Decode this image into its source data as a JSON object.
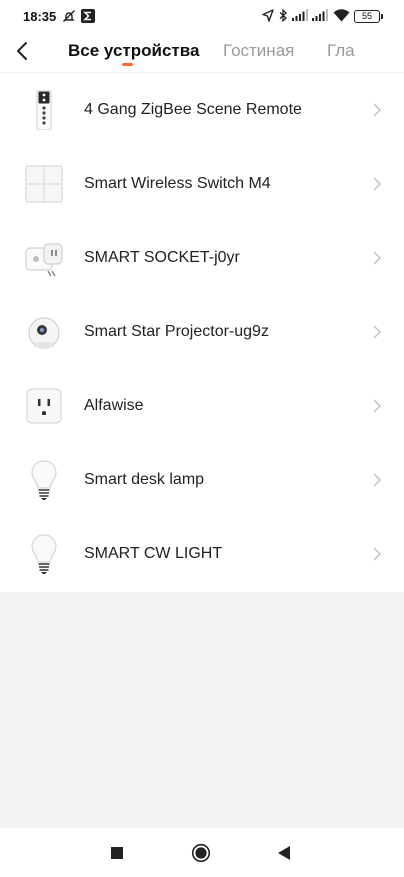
{
  "status_bar": {
    "time": "18:35",
    "battery": "55",
    "icons": [
      "alarm-off-icon",
      "sigma-app-icon",
      "location-icon",
      "bluetooth-icon",
      "signal-icon",
      "signal-icon",
      "wifi-icon",
      "battery-icon"
    ]
  },
  "header": {
    "back_icon": "chevron-left-icon",
    "tabs": [
      {
        "label": "Все устройства",
        "active": true
      },
      {
        "label": "Гостиная",
        "active": false
      },
      {
        "label": "Гла",
        "active": false
      }
    ],
    "accent_color": "#ff6a2c"
  },
  "devices": [
    {
      "name": "4 Gang ZigBee Scene Remote",
      "icon": "scene-remote-icon"
    },
    {
      "name": "Smart Wireless Switch M4",
      "icon": "wall-switch-icon"
    },
    {
      "name": "SMART SOCKET-j0yr",
      "icon": "power-strip-icon"
    },
    {
      "name": "Smart Star Projector-ug9z",
      "icon": "star-projector-icon"
    },
    {
      "name": "Alfawise",
      "icon": "wall-outlet-icon"
    },
    {
      "name": "Smart desk lamp",
      "icon": "light-bulb-icon"
    },
    {
      "name": "SMART CW LIGHT",
      "icon": "light-bulb-icon"
    }
  ],
  "nav_bar": {
    "buttons": [
      "recents-square-icon",
      "home-circle-icon",
      "back-triangle-icon"
    ]
  }
}
